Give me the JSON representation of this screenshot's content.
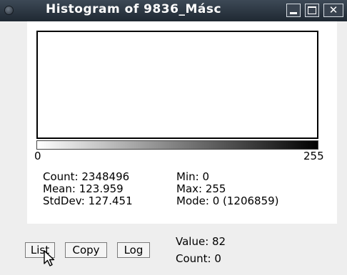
{
  "window": {
    "title": "Histogram of 9836_Másc",
    "close_glyph": "✕"
  },
  "histogram": {
    "axis_min_label": "0",
    "axis_max_label": "255"
  },
  "stats": {
    "count": "Count: 2348496",
    "mean": "Mean: 123.959",
    "stddev": "StdDev: 127.451",
    "min": "Min: 0",
    "max": "Max: 255",
    "mode": "Mode: 0 (1206859)"
  },
  "buttons": {
    "list": "List",
    "copy": "Copy",
    "log": "Log"
  },
  "readout": {
    "value": "Value: 82",
    "count": "Count: 0"
  },
  "icons": {
    "window_menu": "window-menu-icon",
    "minimize": "minimize-icon",
    "maximize": "maximize-icon",
    "close": "close-icon",
    "cursor": "mouse-pointer-icon"
  }
}
